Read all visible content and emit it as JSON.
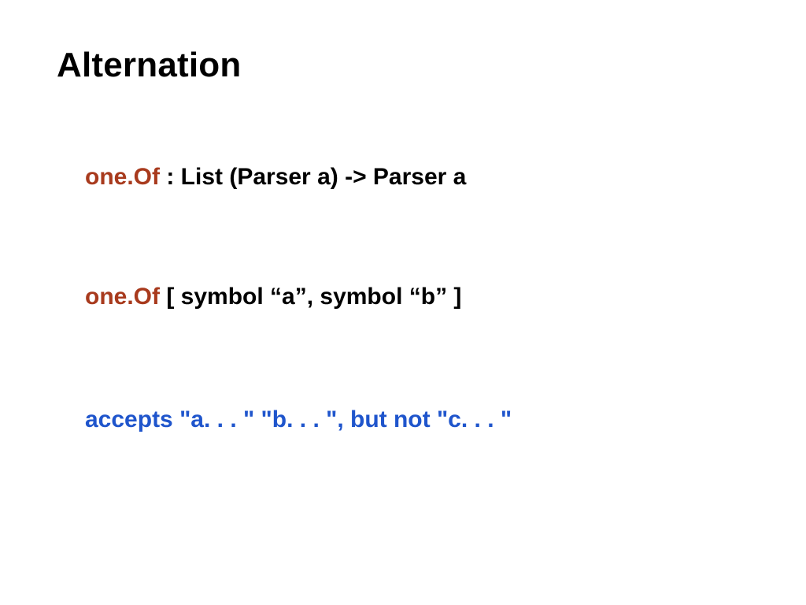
{
  "title": "Alternation",
  "typeSig": {
    "keyword": "one.Of",
    "rest": " : List (Parser a) -> Parser a"
  },
  "usage": {
    "keyword": "one.Of",
    "rest": " [ symbol “a”, symbol “b” ]"
  },
  "accepts": "accepts \"a. . . \" \"b. . . \", but not \"c. . . \""
}
